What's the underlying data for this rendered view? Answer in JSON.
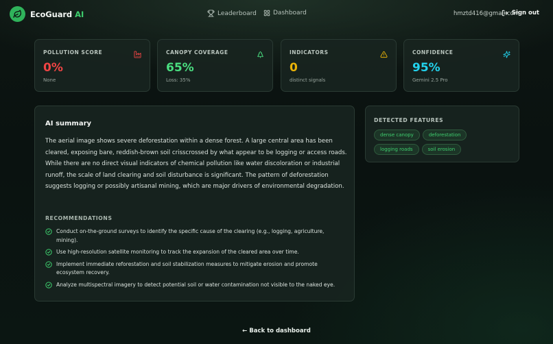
{
  "header": {
    "brand": "EcoGuard",
    "brand_suffix": "AI",
    "nav": [
      {
        "label": "Leaderboard",
        "icon": "trophy-icon"
      },
      {
        "label": "Dashboard",
        "icon": "grid-icon"
      }
    ],
    "email": "hmztd416@gmail.com",
    "signout_label": "Sign out"
  },
  "stats": [
    {
      "label": "POLLUTION SCORE",
      "value": "0%",
      "sub": "None",
      "color": "#ef4444",
      "icon": "factory-icon"
    },
    {
      "label": "CANOPY COVERAGE",
      "value": "65%",
      "sub": "Loss: 35%",
      "color": "#4ade80",
      "icon": "trees-icon"
    },
    {
      "label": "INDICATORS",
      "value": "0",
      "sub": "distinct signals",
      "color": "#eab308",
      "icon": "warning-icon"
    },
    {
      "label": "CONFIDENCE",
      "value": "95%",
      "sub": "Gemini 2.5 Pro",
      "color": "#22d3ee",
      "icon": "sparkles-icon"
    }
  ],
  "summary": {
    "title": "AI summary",
    "text": "The aerial image shows severe deforestation within a dense forest. A large central area has been cleared, exposing bare, reddish-brown soil crisscrossed by what appear to be logging or access roads. While there are no direct visual indicators of chemical pollution like water discoloration or industrial runoff, the scale of land clearing and soil disturbance is significant. The pattern of deforestation suggests logging or possibly artisanal mining, which are major drivers of environmental degradation.",
    "recommendations_title": "RECOMMENDATIONS",
    "recommendations": [
      "Conduct on-the-ground surveys to identify the specific cause of the clearing (e.g., logging, agriculture, mining).",
      "Use high-resolution satellite monitoring to track the expansion of the cleared area over time.",
      "Implement immediate reforestation and soil stabilization measures to mitigate erosion and promote ecosystem recovery.",
      "Analyze multispectral imagery to detect potential soil or water contamination not visible to the naked eye."
    ]
  },
  "features": {
    "title": "DETECTED FEATURES",
    "chips": [
      "dense canopy",
      "deforestation",
      "logging roads",
      "soil erosion"
    ]
  },
  "footer": {
    "back_label": "← Back to dashboard"
  },
  "colors": {
    "accent": "#3ecf6e",
    "background": "#0b1411",
    "card": "#18241f"
  }
}
